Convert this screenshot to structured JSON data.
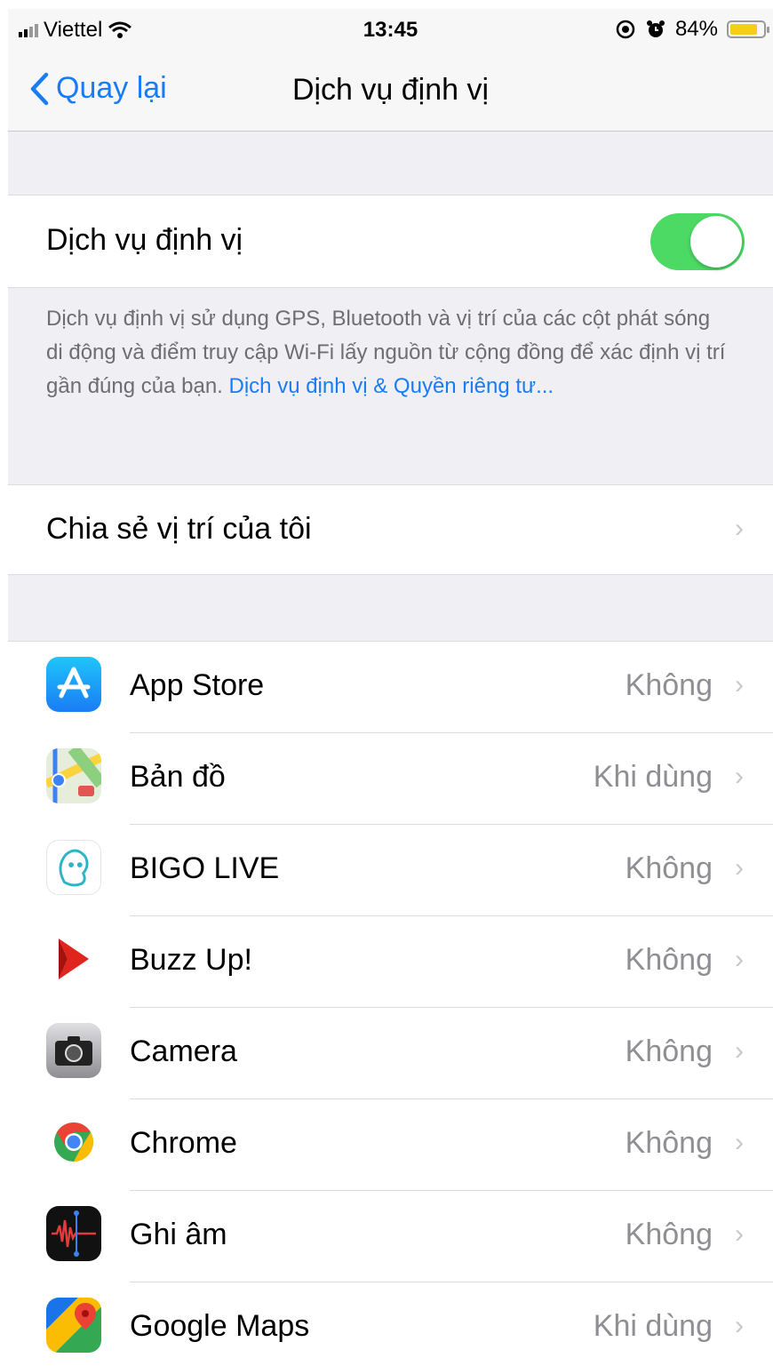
{
  "status_bar": {
    "carrier": "Viettel",
    "time": "13:45",
    "battery": "84%"
  },
  "nav": {
    "back_label": "Quay lại",
    "title": "Dịch vụ định vị"
  },
  "location_services": {
    "label": "Dịch vụ định vị",
    "enabled": true
  },
  "description": {
    "text": "Dịch vụ định vị sử dụng GPS, Bluetooth và vị trí của các cột phát sóng di động và điểm truy cập Wi-Fi lấy nguồn từ cộng đồng để xác định vị trí gần đúng của bạn.",
    "link": "Dịch vụ định vị & Quyền riêng tư..."
  },
  "share_location": {
    "label": "Chia sẻ vị trí của tôi"
  },
  "apps": [
    {
      "name": "App Store",
      "status": "Không",
      "icon": "app-store-icon"
    },
    {
      "name": "Bản đồ",
      "status": "Khi dùng",
      "icon": "maps-icon"
    },
    {
      "name": "BIGO LIVE",
      "status": "Không",
      "icon": "bigo-live-icon"
    },
    {
      "name": "Buzz Up!",
      "status": "Không",
      "icon": "buzz-up-icon"
    },
    {
      "name": "Camera",
      "status": "Không",
      "icon": "camera-icon"
    },
    {
      "name": "Chrome",
      "status": "Không",
      "icon": "chrome-icon"
    },
    {
      "name": "Ghi âm",
      "status": "Không",
      "icon": "voice-memos-icon"
    },
    {
      "name": "Google Maps",
      "status": "Khi dùng",
      "icon": "google-maps-icon"
    }
  ],
  "colors": {
    "accent": "#1a7cf5",
    "toggle_on": "#4cd964",
    "battery": "#f8cc1b"
  }
}
